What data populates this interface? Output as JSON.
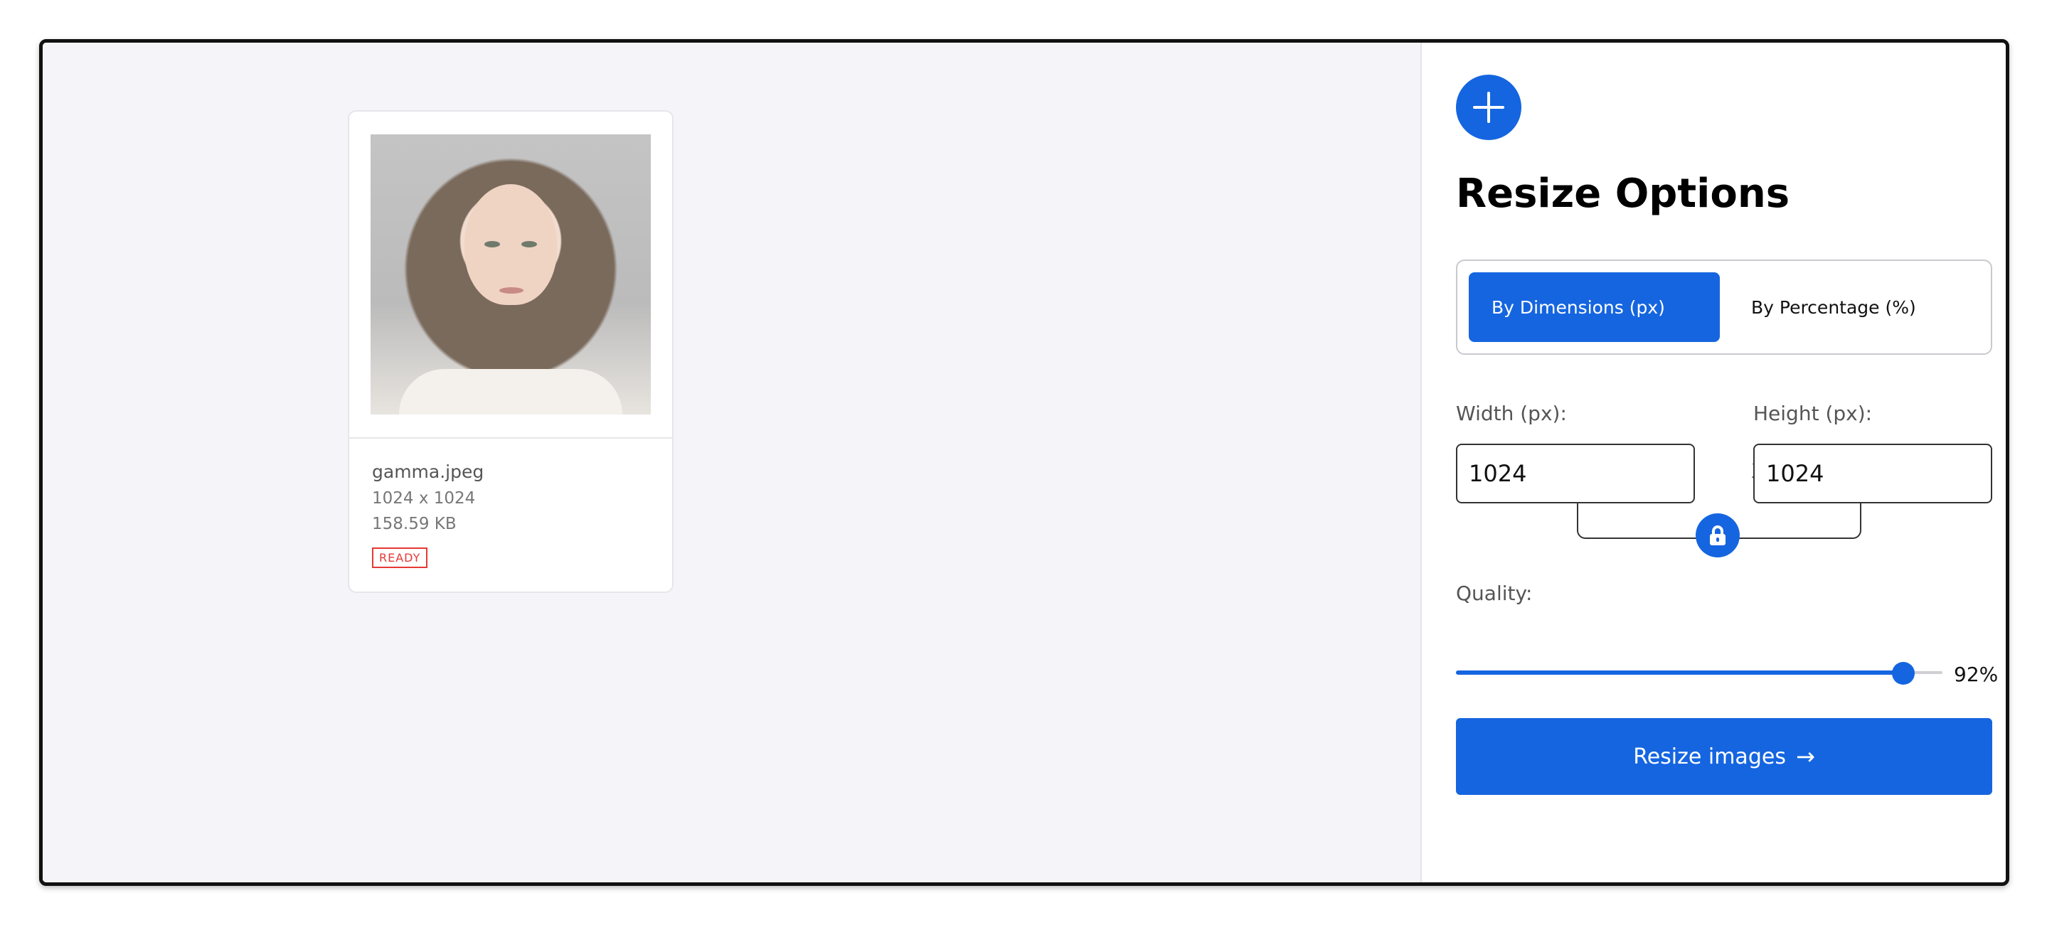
{
  "file": {
    "name": "gamma.jpeg",
    "dimensions": "1024 x 1024",
    "size": "158.59 KB",
    "status": "READY"
  },
  "panel": {
    "title": "Resize Options",
    "add_icon": "plus-icon",
    "modes": [
      {
        "label": "By Dimensions (px)",
        "active": true
      },
      {
        "label": "By Percentage (%)",
        "active": false
      }
    ],
    "width_label": "Width (px):",
    "height_label": "Height (px):",
    "width_value": "1024",
    "height_value": "1024",
    "separator": "X",
    "lock_icon": "lock-icon",
    "quality_label": "Quality:",
    "quality_value": "92%",
    "quality": 0.92,
    "resize_label": "Resize images",
    "resize_arrow": "→"
  },
  "colors": {
    "accent": "#1565e0",
    "ready": "#e53935",
    "workspace_bg": "#f5f5f9"
  }
}
